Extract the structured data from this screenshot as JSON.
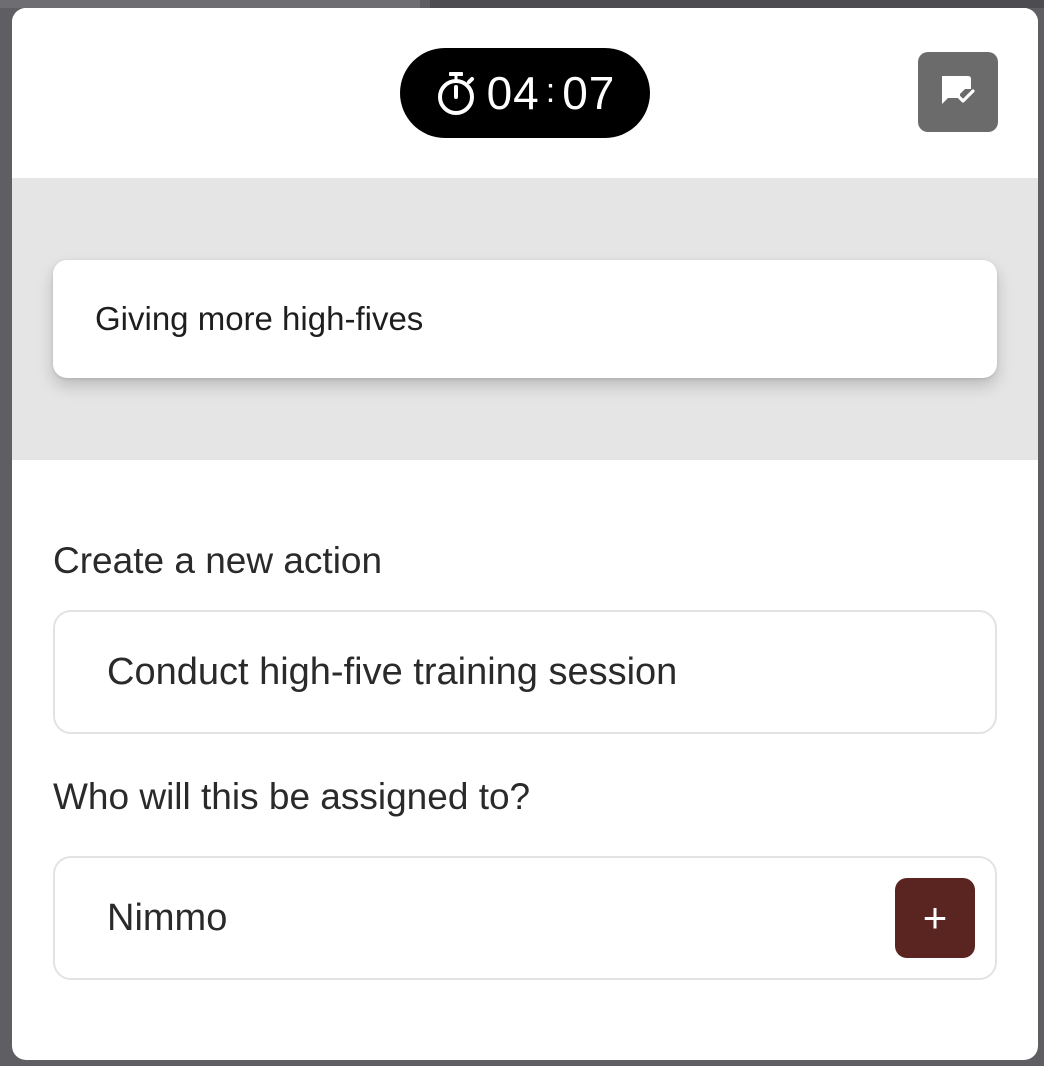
{
  "timer": {
    "minutes": "04",
    "colon": ":",
    "seconds": "07",
    "icon": "stopwatch-icon"
  },
  "header": {
    "finish_icon": "chat-check-icon"
  },
  "topic": {
    "text": "Giving more high-fives"
  },
  "form": {
    "action_label": "Create a new action",
    "action_value": "Conduct high-five training session",
    "assign_label": "Who will this be assigned to?",
    "assign_value": "Nimmo",
    "add_button_label": "+"
  },
  "colors": {
    "timer_bg": "#000000",
    "finish_button": "#6b6b6b",
    "topic_band": "#e5e5e5",
    "add_button": "#5a2420"
  }
}
